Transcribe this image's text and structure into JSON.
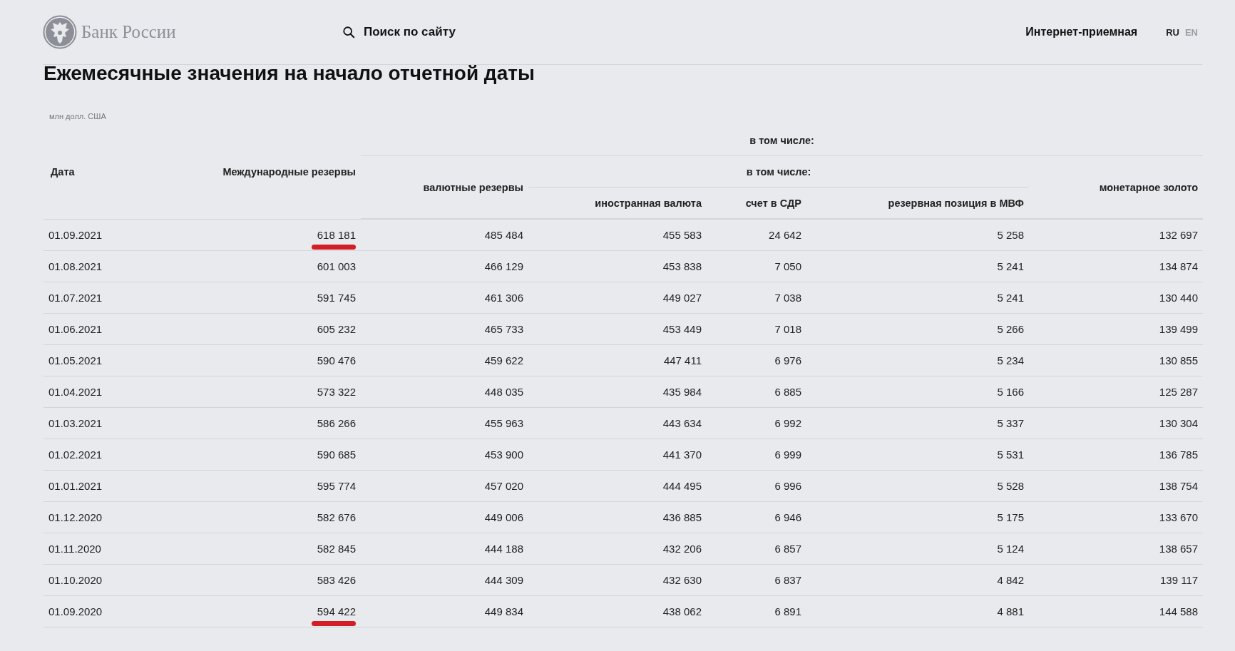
{
  "header": {
    "logo_text": "Банк России",
    "search_label": "Поиск по сайту",
    "reception_link": "Интернет-приемная",
    "languages": [
      {
        "label": "RU",
        "selected": true
      },
      {
        "label": "EN",
        "selected": false
      }
    ]
  },
  "title": "Ежемесячные значения на начало отчетной даты",
  "unit": "млн долл. США",
  "table": {
    "headers": {
      "date": "Дата",
      "total": "Международные резервы",
      "group_1": "в том числе:",
      "currency_reserves": "валютные резервы",
      "group_2": "в том числе:",
      "foreign_currency": "иностранная валюта",
      "sdr": "счет в СДР",
      "imf": "резервная позиция в МВФ",
      "gold": "монетарное золото"
    },
    "rows": [
      {
        "cells": [
          "01.09.2021",
          "618 181",
          "485 484",
          "455 583",
          "24 642",
          "5 258",
          "132 697"
        ],
        "underlined": true
      },
      {
        "cells": [
          "01.08.2021",
          "601 003",
          "466 129",
          "453 838",
          "7 050",
          "5 241",
          "134 874"
        ],
        "underlined": false
      },
      {
        "cells": [
          "01.07.2021",
          "591 745",
          "461 306",
          "449 027",
          "7 038",
          "5 241",
          "130 440"
        ],
        "underlined": false
      },
      {
        "cells": [
          "01.06.2021",
          "605 232",
          "465 733",
          "453 449",
          "7 018",
          "5 266",
          "139 499"
        ],
        "underlined": false
      },
      {
        "cells": [
          "01.05.2021",
          "590 476",
          "459 622",
          "447 411",
          "6 976",
          "5 234",
          "130 855"
        ],
        "underlined": false
      },
      {
        "cells": [
          "01.04.2021",
          "573 322",
          "448 035",
          "435 984",
          "6 885",
          "5 166",
          "125 287"
        ],
        "underlined": false
      },
      {
        "cells": [
          "01.03.2021",
          "586 266",
          "455 963",
          "443 634",
          "6 992",
          "5 337",
          "130 304"
        ],
        "underlined": false
      },
      {
        "cells": [
          "01.02.2021",
          "590 685",
          "453 900",
          "441 370",
          "6 999",
          "5 531",
          "136 785"
        ],
        "underlined": false
      },
      {
        "cells": [
          "01.01.2021",
          "595 774",
          "457 020",
          "444 495",
          "6 996",
          "5 528",
          "138 754"
        ],
        "underlined": false
      },
      {
        "cells": [
          "01.12.2020",
          "582 676",
          "449 006",
          "436 885",
          "6 946",
          "5 175",
          "133 670"
        ],
        "underlined": false
      },
      {
        "cells": [
          "01.11.2020",
          "582 845",
          "444 188",
          "432 206",
          "6 857",
          "5 124",
          "138 657"
        ],
        "underlined": false
      },
      {
        "cells": [
          "01.10.2020",
          "583 426",
          "444 309",
          "432 630",
          "6 837",
          "4 842",
          "139 117"
        ],
        "underlined": false
      },
      {
        "cells": [
          "01.09.2020",
          "594 422",
          "449 834",
          "438 062",
          "6 891",
          "4 881",
          "144 588"
        ],
        "underlined": true
      }
    ]
  }
}
